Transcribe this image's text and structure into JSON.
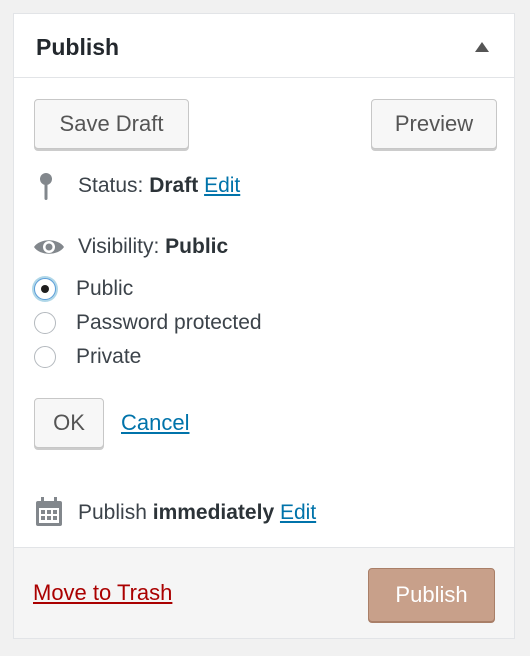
{
  "panel": {
    "title": "Publish"
  },
  "actions": {
    "save_draft": "Save Draft",
    "preview": "Preview"
  },
  "status": {
    "label": "Status:",
    "value": "Draft",
    "edit": "Edit"
  },
  "visibility": {
    "label": "Visibility:",
    "value": "Public",
    "options": [
      {
        "label": "Public",
        "checked": true
      },
      {
        "label": "Password protected",
        "checked": false
      },
      {
        "label": "Private",
        "checked": false
      }
    ],
    "ok": "OK",
    "cancel": "Cancel"
  },
  "schedule": {
    "label": "Publish",
    "value": "immediately",
    "edit": "Edit"
  },
  "footer": {
    "trash": "Move to Trash",
    "publish": "Publish"
  },
  "colors": {
    "link": "#0073aa",
    "trash": "#aa0000",
    "publish_button": "#c8a08a"
  },
  "icons": {
    "status": "pin-icon",
    "visibility": "eye-icon",
    "schedule": "calendar-icon",
    "toggle": "triangle-up-icon"
  }
}
